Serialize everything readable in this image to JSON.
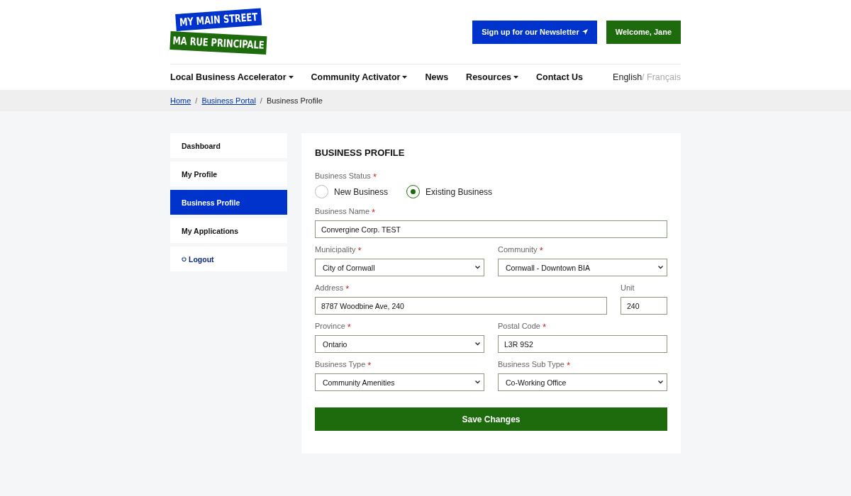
{
  "logo": {
    "line_1": "MY MAIN STREET",
    "line_2": "MA RUE PRINCIPALE"
  },
  "header_buttons": [
    {
      "kind": "newsletter",
      "label": "Sign up for our Newsletter"
    },
    {
      "kind": "account",
      "label": "Welcome, Jane"
    }
  ],
  "nav": [
    {
      "label": "Local Business Accelerator",
      "dropdown": true
    },
    {
      "label": "Community Activator",
      "dropdown": true
    },
    {
      "label": "News",
      "dropdown": false
    },
    {
      "label": "Resources",
      "dropdown": true
    },
    {
      "label": "Contact Us",
      "dropdown": false
    }
  ],
  "languages": [
    {
      "label": "English",
      "selected": true
    },
    {
      "label": "/ Français",
      "selected": false
    }
  ],
  "breadcrumb": [
    {
      "label": "Home",
      "link": true
    },
    {
      "separator": "/",
      "label": "Business Portal",
      "link": true
    },
    {
      "separator": "/",
      "label": "Business Profile",
      "link": false
    }
  ],
  "sidebar": [
    {
      "label": "Dashboard",
      "selected": false,
      "kind": "page"
    },
    {
      "label": "My Profile",
      "selected": false,
      "kind": "page"
    },
    {
      "label": "Business Profile",
      "selected": true,
      "kind": "page"
    },
    {
      "label": "My Applications",
      "selected": false,
      "kind": "page"
    },
    {
      "label": "Logout",
      "selected": false,
      "kind": "logout"
    }
  ],
  "form": {
    "title": "BUSINESS PROFILE",
    "status": {
      "label": "Business Status",
      "required_mark": "*",
      "options": [
        {
          "label": "New Business",
          "selected": false
        },
        {
          "label": "Existing Business",
          "selected": true
        }
      ]
    },
    "rows": [
      {
        "kind": "single",
        "fields": [
          {
            "label": "Business Name",
            "required_mark": "*",
            "kind": "text",
            "value": "Convergine Corp. TEST"
          }
        ]
      },
      {
        "kind": "pair",
        "fields": [
          {
            "label": "Municipality",
            "required_mark": "*",
            "kind": "select",
            "value": "City of Cornwall"
          },
          {
            "label": "Community",
            "required_mark": "*",
            "kind": "select",
            "value": "Cornwall - Downtown BIA"
          }
        ]
      },
      {
        "kind": "main-unit",
        "fields": [
          {
            "label": "Address",
            "required_mark": "*",
            "kind": "text",
            "value": "8787 Woodbine Ave, 240"
          },
          {
            "label": "Unit",
            "kind": "text",
            "value": "240"
          }
        ]
      },
      {
        "kind": "pair",
        "fields": [
          {
            "label": "Province",
            "required_mark": "*",
            "kind": "select",
            "value": "Ontario"
          },
          {
            "label": "Postal Code",
            "required_mark": "*",
            "kind": "text",
            "value": "L3R 9S2"
          }
        ]
      },
      {
        "kind": "pair",
        "fields": [
          {
            "label": "Business Type",
            "required_mark": "*",
            "kind": "select",
            "value": "Community Amenities"
          },
          {
            "label": "Business Sub Type",
            "required_mark": "*",
            "kind": "select",
            "value": "Co-Working Office"
          }
        ]
      }
    ],
    "submit": "Save Changes"
  }
}
